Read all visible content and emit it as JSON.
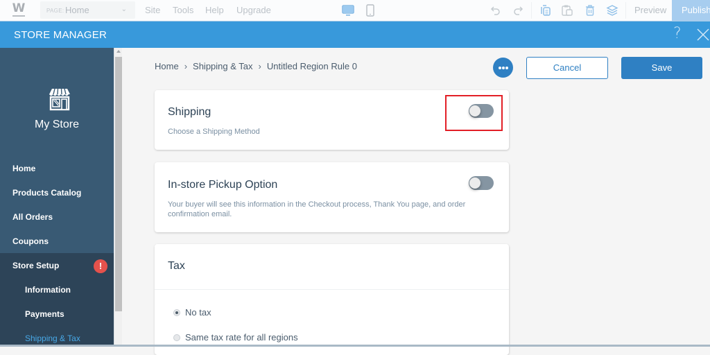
{
  "topbar": {
    "logo": "W",
    "page_prefix": "PAGE:",
    "page_value": "Home",
    "menu": [
      "Site",
      "Tools",
      "Help",
      "Upgrade"
    ],
    "icons": [
      "desktop-view-icon",
      "mobile-view-icon",
      "undo-icon",
      "redo-icon",
      "copy-icon",
      "paste-icon",
      "delete-icon",
      "layers-icon"
    ],
    "preview_label": "Preview",
    "publish_label": "Publish"
  },
  "header": {
    "title": "STORE MANAGER",
    "help_label": "?"
  },
  "sidebar": {
    "store_name": "My Store",
    "items": [
      {
        "label": "Home"
      },
      {
        "label": "Products Catalog"
      },
      {
        "label": "All Orders"
      },
      {
        "label": "Coupons"
      },
      {
        "label": "Store Setup",
        "badge": "!"
      }
    ],
    "subitems": [
      {
        "label": "Information"
      },
      {
        "label": "Payments"
      },
      {
        "label": "Shipping & Tax",
        "active": true
      }
    ]
  },
  "breadcrumb": [
    "Home",
    "Shipping & Tax",
    "Untitled Region Rule 0"
  ],
  "actions": {
    "cancel_label": "Cancel",
    "save_label": "Save"
  },
  "cards": {
    "shipping": {
      "title": "Shipping",
      "description": "Choose a Shipping Method",
      "enabled": false
    },
    "pickup": {
      "title": "In-store Pickup Option",
      "description": "Your buyer will see this information in the Checkout process, Thank You page, and order confirmation email.",
      "enabled": false
    },
    "tax": {
      "title": "Tax",
      "options": [
        {
          "label": "No tax",
          "selected": true
        },
        {
          "label": "Same tax rate for all regions",
          "selected": false
        }
      ]
    }
  },
  "colors": {
    "accent": "#3899db",
    "button_primary": "#2f80c3",
    "sidebar": "#395a74",
    "sidebar_sub": "#2d4458",
    "alert": "#e5524c",
    "highlight": "#e21f26"
  }
}
